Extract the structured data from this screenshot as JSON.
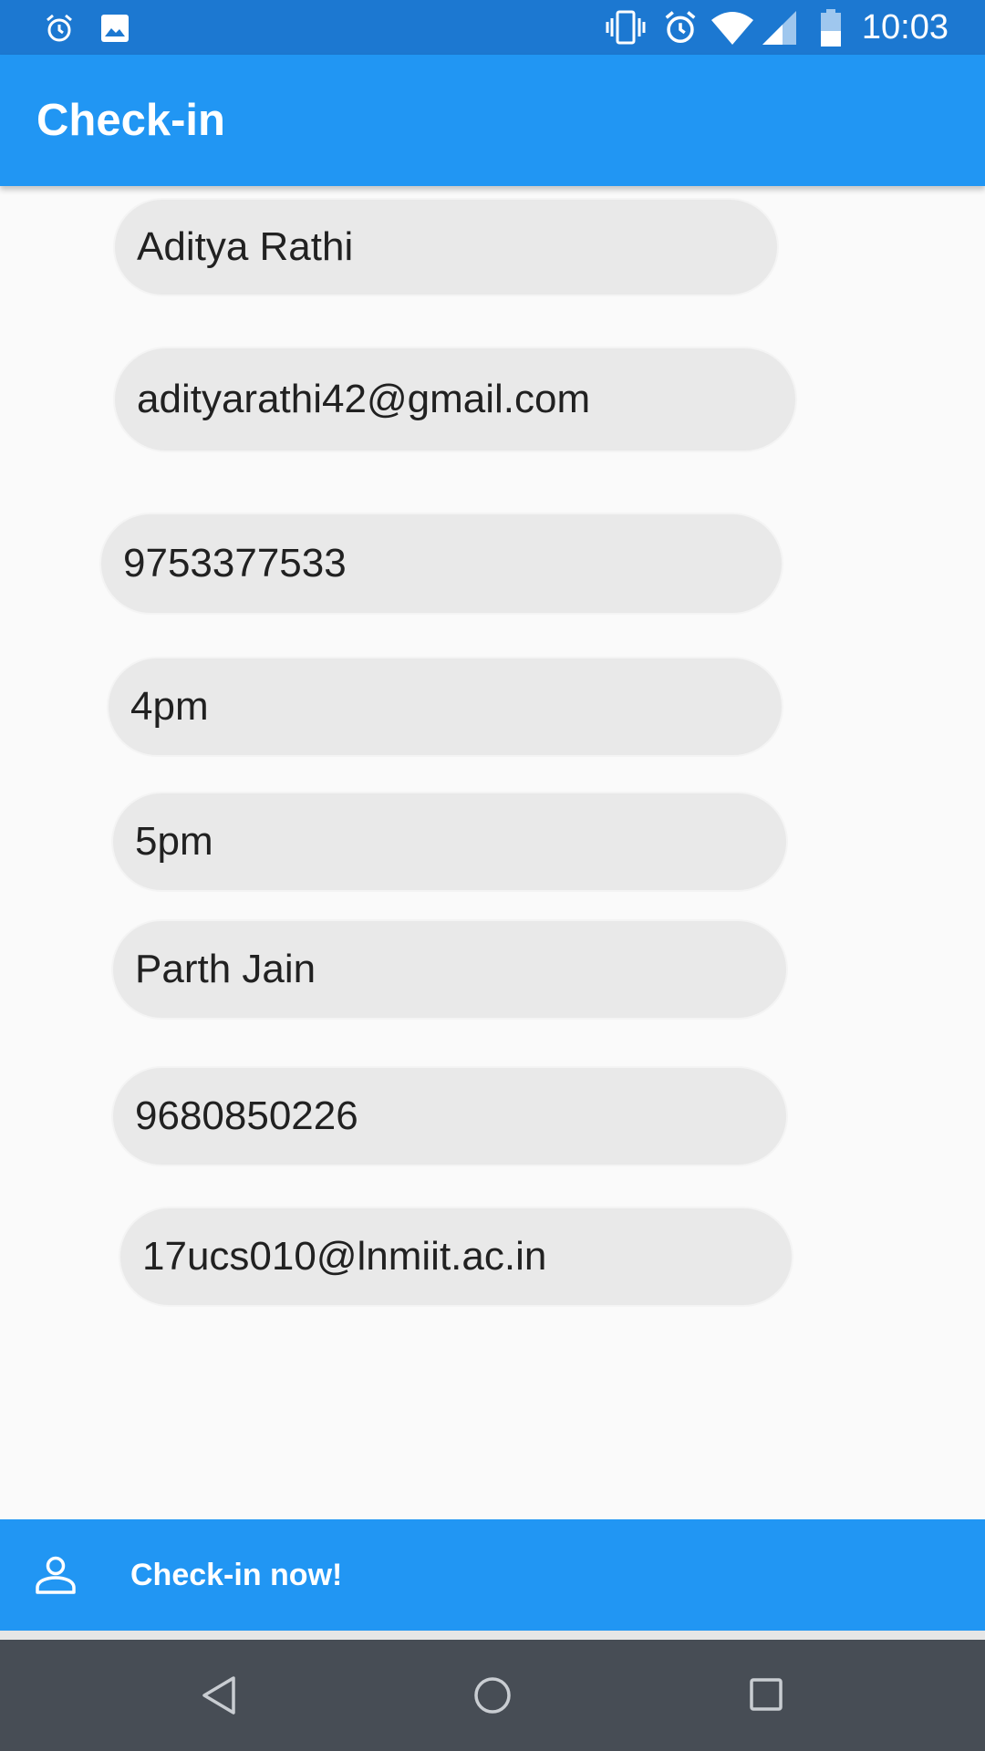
{
  "status_bar": {
    "time": "10:03",
    "icons": [
      "alarm-icon",
      "image-icon",
      "vibrate-icon",
      "alarm-icon",
      "wifi-icon",
      "cellular-signal-icon",
      "battery-icon"
    ]
  },
  "app_bar": {
    "title": "Check-in"
  },
  "form": {
    "fields": [
      {
        "name": "name",
        "value": "Aditya Rathi"
      },
      {
        "name": "email",
        "value": "adityarathi42@gmail.com"
      },
      {
        "name": "phone",
        "value": "9753377533"
      },
      {
        "name": "start-time",
        "value": "4pm"
      },
      {
        "name": "end-time",
        "value": "5pm"
      },
      {
        "name": "contact-name",
        "value": "Parth Jain"
      },
      {
        "name": "contact-phone",
        "value": "9680850226"
      },
      {
        "name": "contact-email",
        "value": "17ucs010@lnmiit.ac.in"
      }
    ]
  },
  "checkin_button": {
    "label": "Check-in now!",
    "icon": "person-icon"
  },
  "nav_bar": {
    "icons": [
      "back-icon",
      "home-icon",
      "recents-icon"
    ]
  },
  "colors": {
    "status_bar": "#1c78d1",
    "primary": "#2196f3",
    "field_bg": "#e9e9e9",
    "nav_bar": "#474d55",
    "background": "#fafafa"
  }
}
